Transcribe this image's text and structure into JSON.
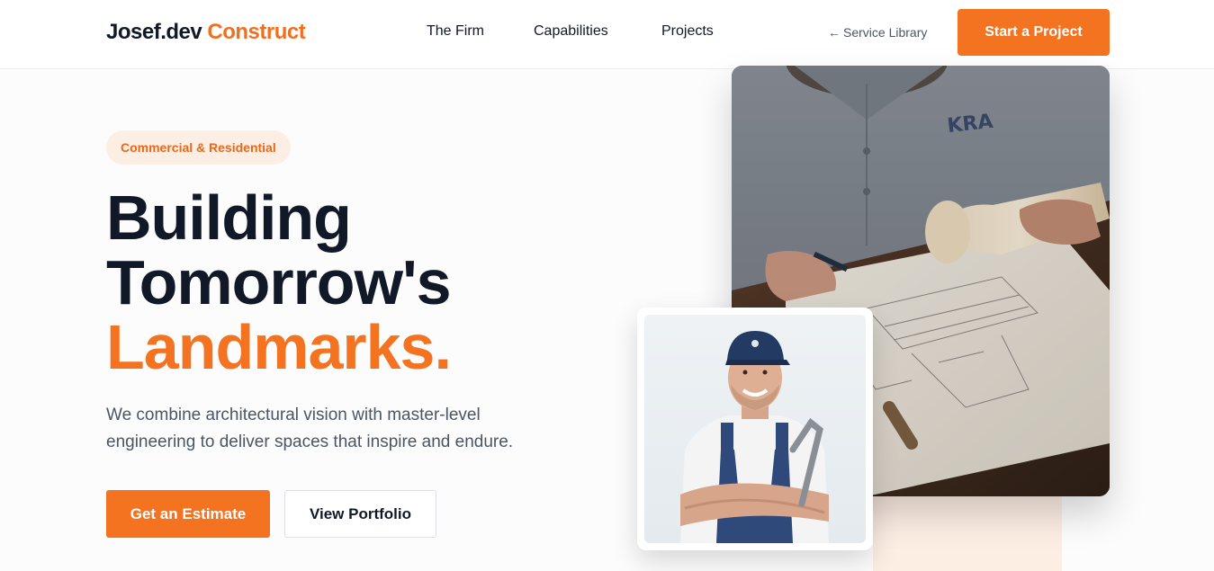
{
  "header": {
    "logo_brand": "Josef.dev",
    "logo_accent": "Construct",
    "nav": [
      {
        "label": "The Firm"
      },
      {
        "label": "Capabilities"
      },
      {
        "label": "Projects"
      }
    ],
    "service_arrow": "←",
    "service_label": "Service Library",
    "cta_label": "Start a Project"
  },
  "hero": {
    "badge": "Commercial & Residential",
    "headline_line1": "Building",
    "headline_line2": "Tomorrow's",
    "headline_line3": "Landmarks.",
    "subtext": "We combine architectural vision with master-level engineering to deliver spaces that inspire and endure.",
    "primary_button": "Get an Estimate",
    "secondary_button": "View Portfolio"
  },
  "images": {
    "main_photo_shirt_text": "KRA"
  },
  "colors": {
    "accent": "#f47321",
    "accent_soft": "#fdeee4",
    "text_dark": "#111827",
    "text_muted": "#4b5563"
  }
}
